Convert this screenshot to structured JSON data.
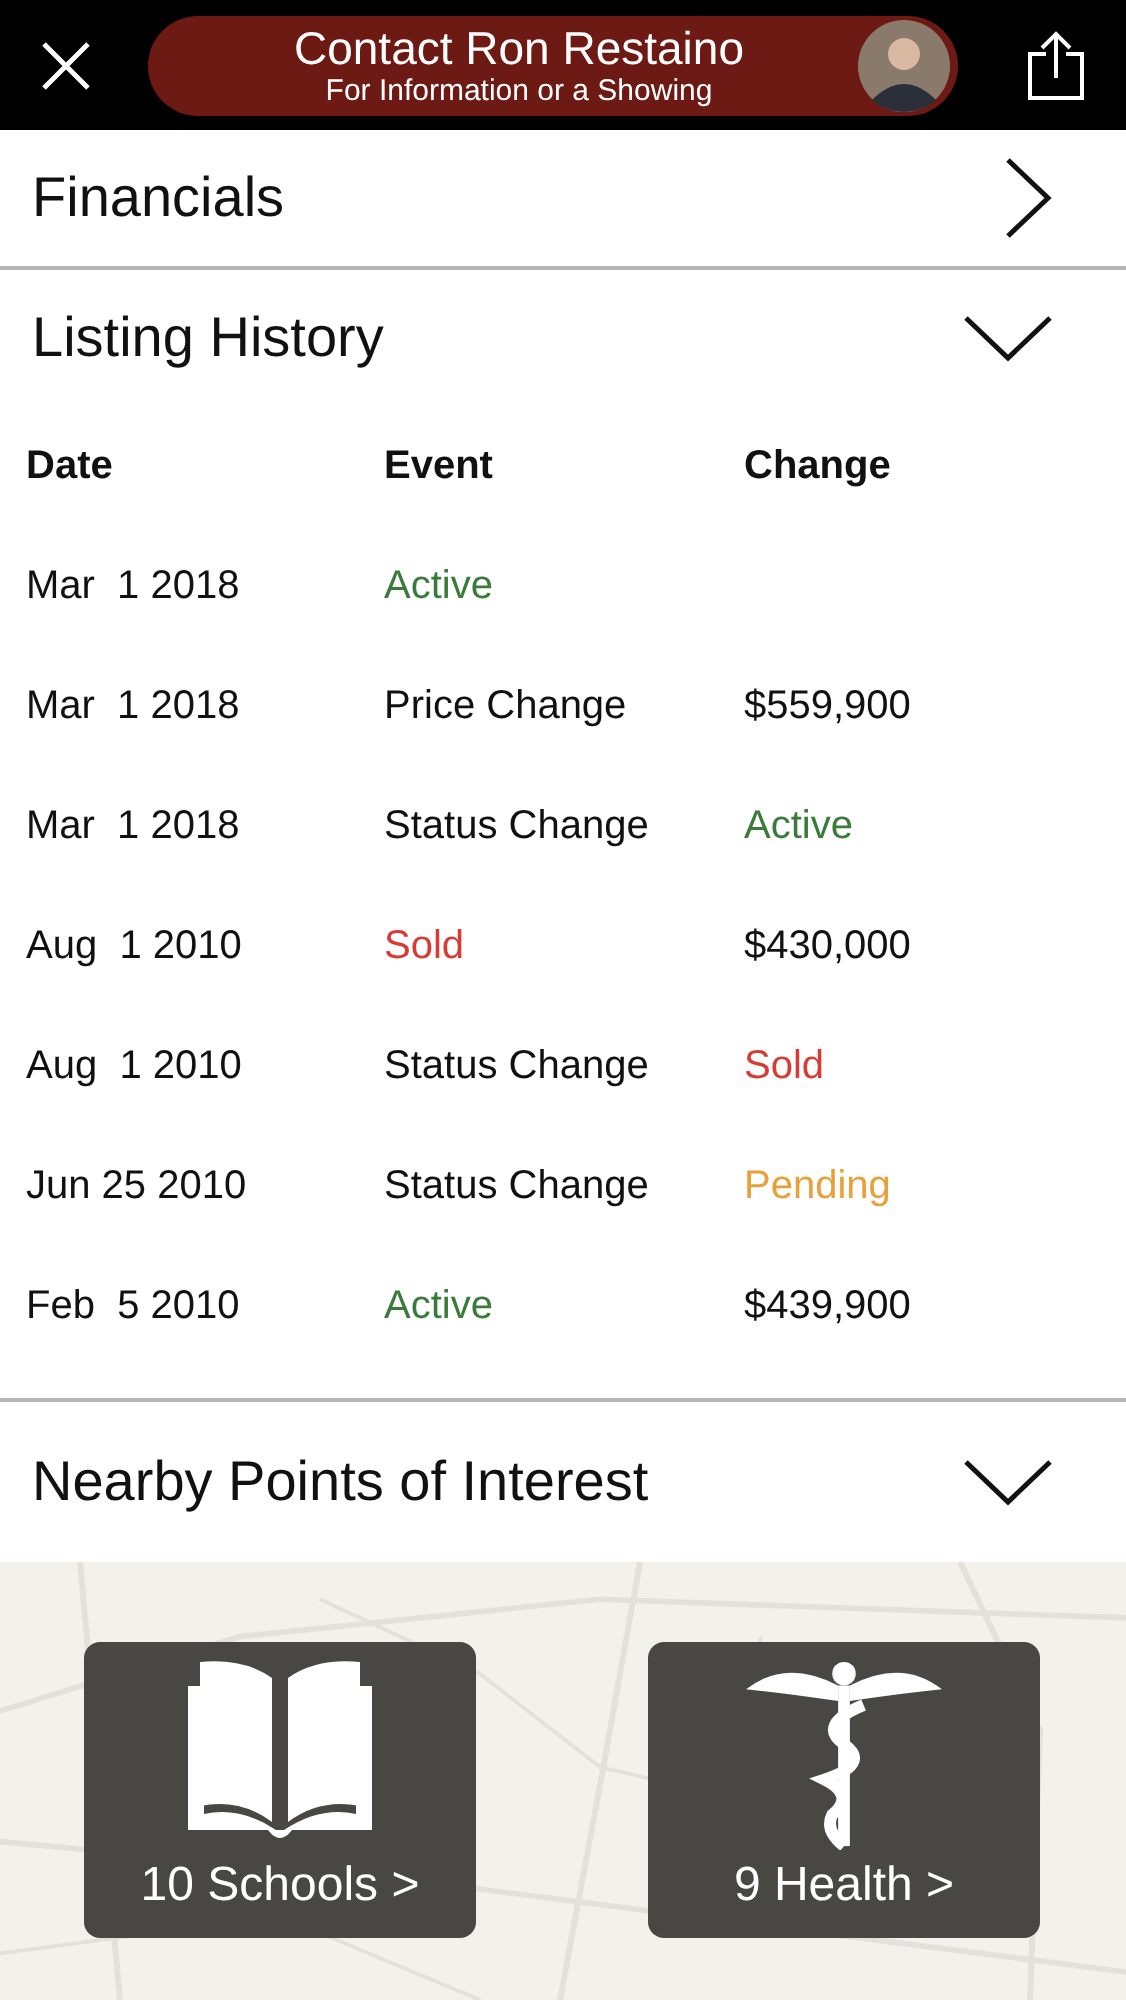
{
  "header": {
    "title": "Contact Ron Restaino",
    "subtitle": "For Information or a Showing"
  },
  "sections": [
    {
      "title": "Financials",
      "expanded": false
    },
    {
      "title": "Listing History",
      "expanded": true
    },
    {
      "title": "Nearby Points of Interest",
      "expanded": true
    }
  ],
  "table": {
    "columns": [
      "Date",
      "Event",
      "Change"
    ],
    "rows": [
      {
        "date": "Mar  1 2018",
        "event": {
          "text": "Active",
          "color": "#3a7a3a"
        },
        "change": null
      },
      {
        "date": "Mar  1 2018",
        "event": {
          "text": "Price Change",
          "color": "#111111"
        },
        "change": {
          "text": "$559,900",
          "color": "#111111"
        }
      },
      {
        "date": "Mar  1 2018",
        "event": {
          "text": "Status Change",
          "color": "#111111"
        },
        "change": {
          "text": "Active",
          "color": "#3a7a3a"
        }
      },
      {
        "date": "Aug  1 2010",
        "event": {
          "text": "Sold",
          "color": "#d93a32"
        },
        "change": {
          "text": "$430,000",
          "color": "#111111"
        }
      },
      {
        "date": "Aug  1 2010",
        "event": {
          "text": "Status Change",
          "color": "#111111"
        },
        "change": {
          "text": "Sold",
          "color": "#d93a32"
        }
      },
      {
        "date": "Jun 25 2010",
        "event": {
          "text": "Status Change",
          "color": "#111111"
        },
        "change": {
          "text": "Pending",
          "color": "#e8a03a"
        }
      },
      {
        "date": "Feb  5 2010",
        "event": {
          "text": "Active",
          "color": "#3a7a3a"
        },
        "change": {
          "text": "$439,900",
          "color": "#111111"
        }
      }
    ]
  },
  "poi": [
    {
      "kind": "schools",
      "label": "10 Schools >"
    },
    {
      "kind": "health",
      "label": "9 Health >"
    }
  ]
}
